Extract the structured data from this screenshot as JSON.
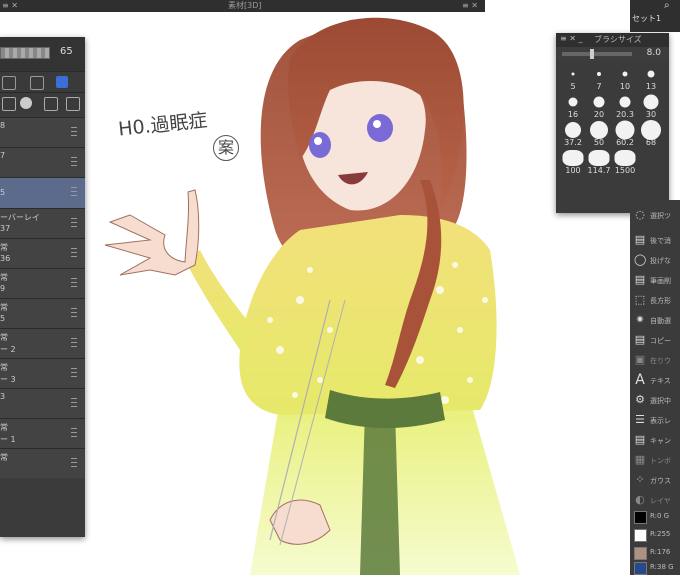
{
  "top_bar": {
    "title": "素材[3D]"
  },
  "layers_panel": {
    "opacity_value": "65",
    "rows": [
      {
        "line1": "8",
        "line2": ""
      },
      {
        "line1": "7",
        "line2": ""
      },
      {
        "line1": "",
        "line2": ""
      },
      {
        "line1": "5",
        "line2": ""
      },
      {
        "line1": "ーバーレイ",
        "line2": "37"
      },
      {
        "line1": "常",
        "line2": "36"
      },
      {
        "line1": "常",
        "line2": "9"
      },
      {
        "line1": "常",
        "line2": "5"
      },
      {
        "line1": "常",
        "line2": "ー 2"
      },
      {
        "line1": "常",
        "line2": "ー 3"
      },
      {
        "line1": "3",
        "line2": ""
      },
      {
        "line1": "常",
        "line2": "ー 1"
      },
      {
        "line1": "常",
        "line2": ""
      }
    ]
  },
  "brush_panel": {
    "title": "ブラシサイズ",
    "value": "8.0",
    "sizes": [
      "5",
      "7",
      "10",
      "13",
      "16",
      "20",
      "20.3",
      "30",
      "37.2",
      "50",
      "60.2",
      "68",
      "100",
      "114.7",
      "1500"
    ]
  },
  "right_column": {
    "set_label": "セット1",
    "items": [
      {
        "icon": "lasso-icon",
        "label": "選択ツ"
      },
      {
        "icon": "folder-icon",
        "label": "後で消"
      },
      {
        "icon": "speech-icon",
        "label": "投げな"
      },
      {
        "icon": "folder-icon",
        "label": "筆画削"
      },
      {
        "icon": "rect-select-icon",
        "label": "長方形"
      },
      {
        "icon": "sparkle-icon",
        "label": "自動選"
      },
      {
        "icon": "folder-icon",
        "label": "コピー"
      },
      {
        "icon": "copy-icon",
        "label": "在りウ"
      },
      {
        "icon": "text-icon",
        "label": "テキス"
      },
      {
        "icon": "gear-icon",
        "label": "選択中"
      },
      {
        "icon": "layers-icon",
        "label": "表示レ"
      },
      {
        "icon": "folder-icon",
        "label": "キャン"
      },
      {
        "icon": "tone-icon",
        "label": "トンボ"
      },
      {
        "icon": "blur-icon",
        "label": "ガウス"
      },
      {
        "icon": "circle-icon",
        "label": "レイヤ"
      },
      {
        "icon": "swatch-black",
        "label": "R:0 G"
      },
      {
        "icon": "swatch-white",
        "label": "R:255"
      },
      {
        "icon": "swatch-brown",
        "label": "R:176"
      },
      {
        "icon": "swatch-blue",
        "label": "R:38 G"
      }
    ]
  },
  "artwork": {
    "handwriting_line1": "H0.過眠症",
    "handwriting_line2": "案"
  },
  "colors": {
    "panel": "#3b3b3b",
    "selected_layer": "#5c6a8c",
    "hair": "#a8523a",
    "dress_yellow": "#f0dc6a",
    "sash_green": "#5b7a3b",
    "skin": "#f7ddd0",
    "eye": "#7a6ad8"
  }
}
